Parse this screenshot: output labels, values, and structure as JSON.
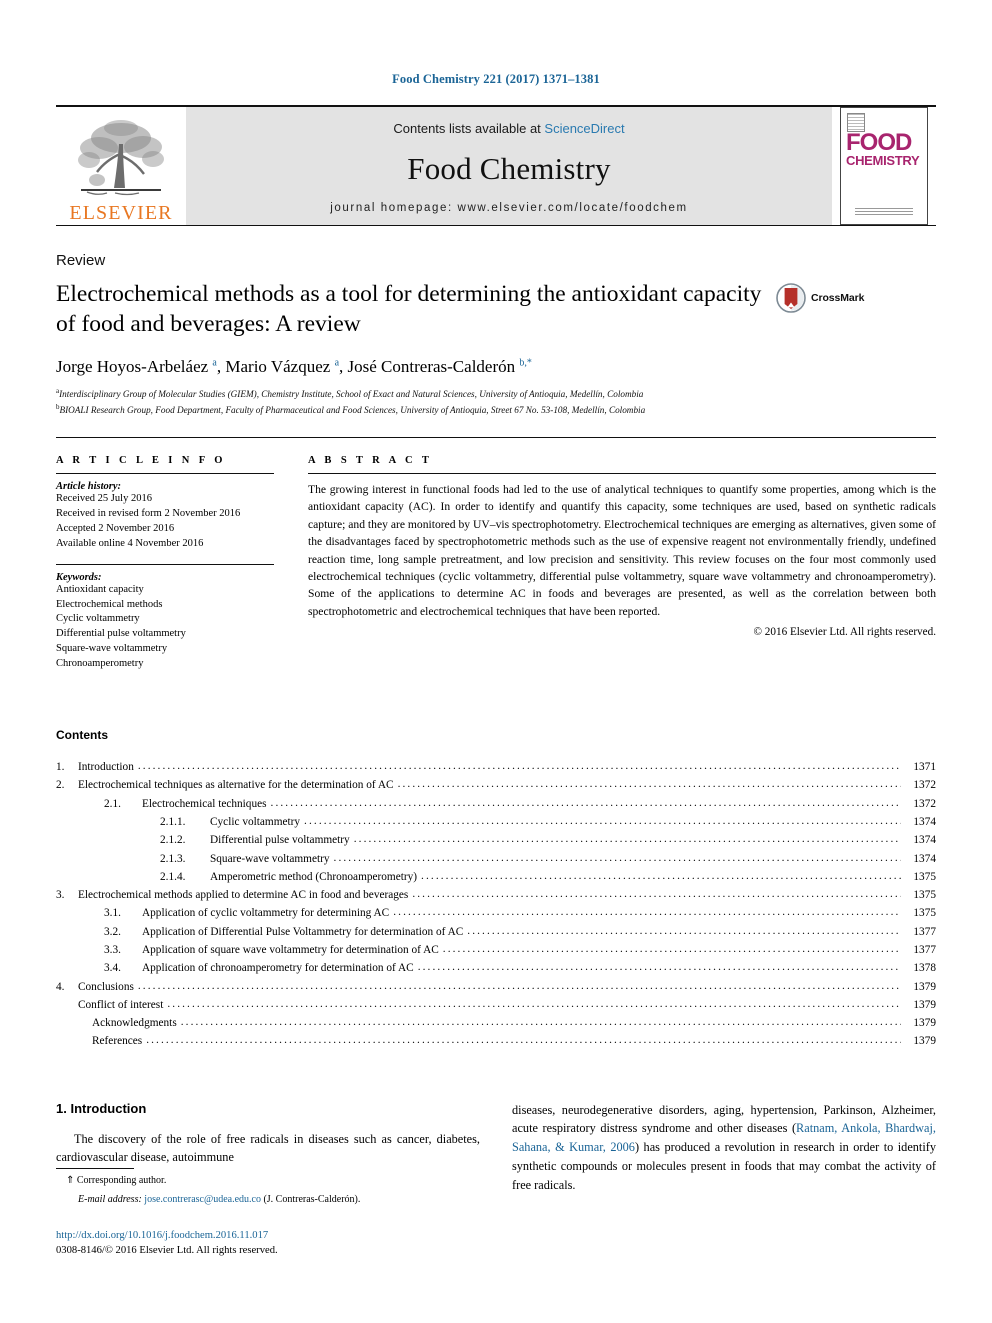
{
  "running_head": "Food Chemistry 221 (2017) 1371–1381",
  "banner": {
    "contents_prefix": "Contents lists available at ",
    "sciencedirect": "ScienceDirect",
    "journal_name": "Food Chemistry",
    "homepage": "journal homepage: www.elsevier.com/locate/foodchem",
    "publisher_logo_text": "ELSEVIER",
    "cover": {
      "line1": "FOOD",
      "line2": "CHEMISTRY"
    },
    "accent_color": "#2a7ab0",
    "elsevier_orange": "#E87722",
    "cover_magenta": "#A8246E"
  },
  "article": {
    "doctype": "Review",
    "title": "Electrochemical methods as a tool for determining the antioxidant capacity of food and beverages: A review",
    "crossmark_label": "CrossMark",
    "authors_html": "Jorge Hoyos-Arbeláez <sup>a</sup>, Mario Vázquez <sup>a</sup>, José Contreras-Calderón <sup>b,*</sup>",
    "affiliations": [
      "Interdisciplinary Group of Molecular Studies (GIEM), Chemistry Institute, School of Exact and Natural Sciences, University of Antioquia, Medellín, Colombia",
      "BIOALI Research Group, Food Department, Faculty of Pharmaceutical and Food Sciences, University of Antioquia, Street 67 No. 53-108, Medellín, Colombia"
    ],
    "affiliation_marks": [
      "a",
      "b"
    ]
  },
  "article_info": {
    "heading": "A R T I C L E   I N F O",
    "history_title": "Article history:",
    "history": [
      "Received 25 July 2016",
      "Received in revised form 2 November 2016",
      "Accepted 2 November 2016",
      "Available online 4 November 2016"
    ],
    "keywords_title": "Keywords:",
    "keywords": [
      "Antioxidant capacity",
      "Electrochemical methods",
      "Cyclic voltammetry",
      "Differential pulse voltammetry",
      "Square-wave voltammetry",
      "Chronoamperometry"
    ]
  },
  "abstract": {
    "heading": "A B S T R A C T",
    "text": "The growing interest in functional foods had led to the use of analytical techniques to quantify some properties, among which is the antioxidant capacity (AC). In order to identify and quantify this capacity, some techniques are used, based on synthetic radicals capture; and they are monitored by UV–vis spectrophotometry. Electrochemical techniques are emerging as alternatives, given some of the disadvantages faced by spectrophotometric methods such as the use of expensive reagent not environmentally friendly, undefined reaction time, long sample pretreatment, and low precision and sensitivity. This review focuses on the four most commonly used electrochemical techniques (cyclic voltammetry, differential pulse voltammetry, square wave voltammetry and chronoamperometry). Some of the applications to determine AC in foods and beverages are presented, as well as the correlation between both spectrophotometric and electrochemical techniques that have been reported.",
    "copyright": "© 2016 Elsevier Ltd. All rights reserved."
  },
  "contents": {
    "heading": "Contents",
    "entries": [
      {
        "level": 1,
        "num": "1.",
        "label": "Introduction",
        "page": "1371"
      },
      {
        "level": 1,
        "num": "2.",
        "label": "Electrochemical techniques as alternative for the determination of AC",
        "page": "1372"
      },
      {
        "level": 2,
        "num": "2.1.",
        "label": "Electrochemical techniques",
        "page": "1372"
      },
      {
        "level": 3,
        "num": "2.1.1.",
        "label": "Cyclic voltammetry",
        "page": "1374"
      },
      {
        "level": 3,
        "num": "2.1.2.",
        "label": "Differential pulse voltammetry",
        "page": "1374"
      },
      {
        "level": 3,
        "num": "2.1.3.",
        "label": "Square-wave voltammetry",
        "page": "1374"
      },
      {
        "level": 3,
        "num": "2.1.4.",
        "label": "Amperometric method (Chronoamperometry)",
        "page": "1375"
      },
      {
        "level": 1,
        "num": "3.",
        "label": "Electrochemical methods applied to determine AC in food and beverages",
        "page": "1375"
      },
      {
        "level": 2,
        "num": "3.1.",
        "label": "Application of cyclic voltammetry for determining AC",
        "page": "1375"
      },
      {
        "level": 2,
        "num": "3.2.",
        "label": "Application of Differential Pulse Voltammetry for determination of AC",
        "page": "1377"
      },
      {
        "level": 2,
        "num": "3.3.",
        "label": "Application of square wave voltammetry for determination of AC",
        "page": "1377"
      },
      {
        "level": 2,
        "num": "3.4.",
        "label": "Application of chronoamperometry for determination of AC",
        "page": "1378"
      },
      {
        "level": 1,
        "num": "4.",
        "label": "Conclusions",
        "page": "1379"
      },
      {
        "level": 5,
        "num": "",
        "label": "Conflict of interest",
        "page": "1379"
      },
      {
        "level": 6,
        "num": "",
        "label": "Acknowledgments",
        "page": "1379"
      },
      {
        "level": 6,
        "num": "",
        "label": "References",
        "page": "1379"
      }
    ]
  },
  "introduction": {
    "heading": "1. Introduction",
    "col_left": "The discovery of the role of free radicals in diseases such as cancer, diabetes, cardiovascular disease, autoimmune",
    "col_right_pre": "diseases, neurodegenerative disorders, aging, hypertension, Parkinson, Alzheimer, acute respiratory distress syndrome and other diseases (",
    "col_right_cite": "Ratnam, Ankola, Bhardwaj, Sahana, & Kumar, 2006",
    "col_right_post": ") has produced a revolution in research in order to identify synthetic compounds or molecules present in foods that may combat the activity of free radicals."
  },
  "footer": {
    "corresponding_marker": "⇑",
    "corresponding_label": "Corresponding author.",
    "email_label": "E-mail address:",
    "email": "jose.contrerasc@udea.edu.co",
    "email_owner": "(J. Contreras-Calderón).",
    "doi": "http://dx.doi.org/10.1016/j.foodchem.2016.11.017",
    "issn_copyright": "0308-8146/© 2016 Elsevier Ltd. All rights reserved."
  }
}
